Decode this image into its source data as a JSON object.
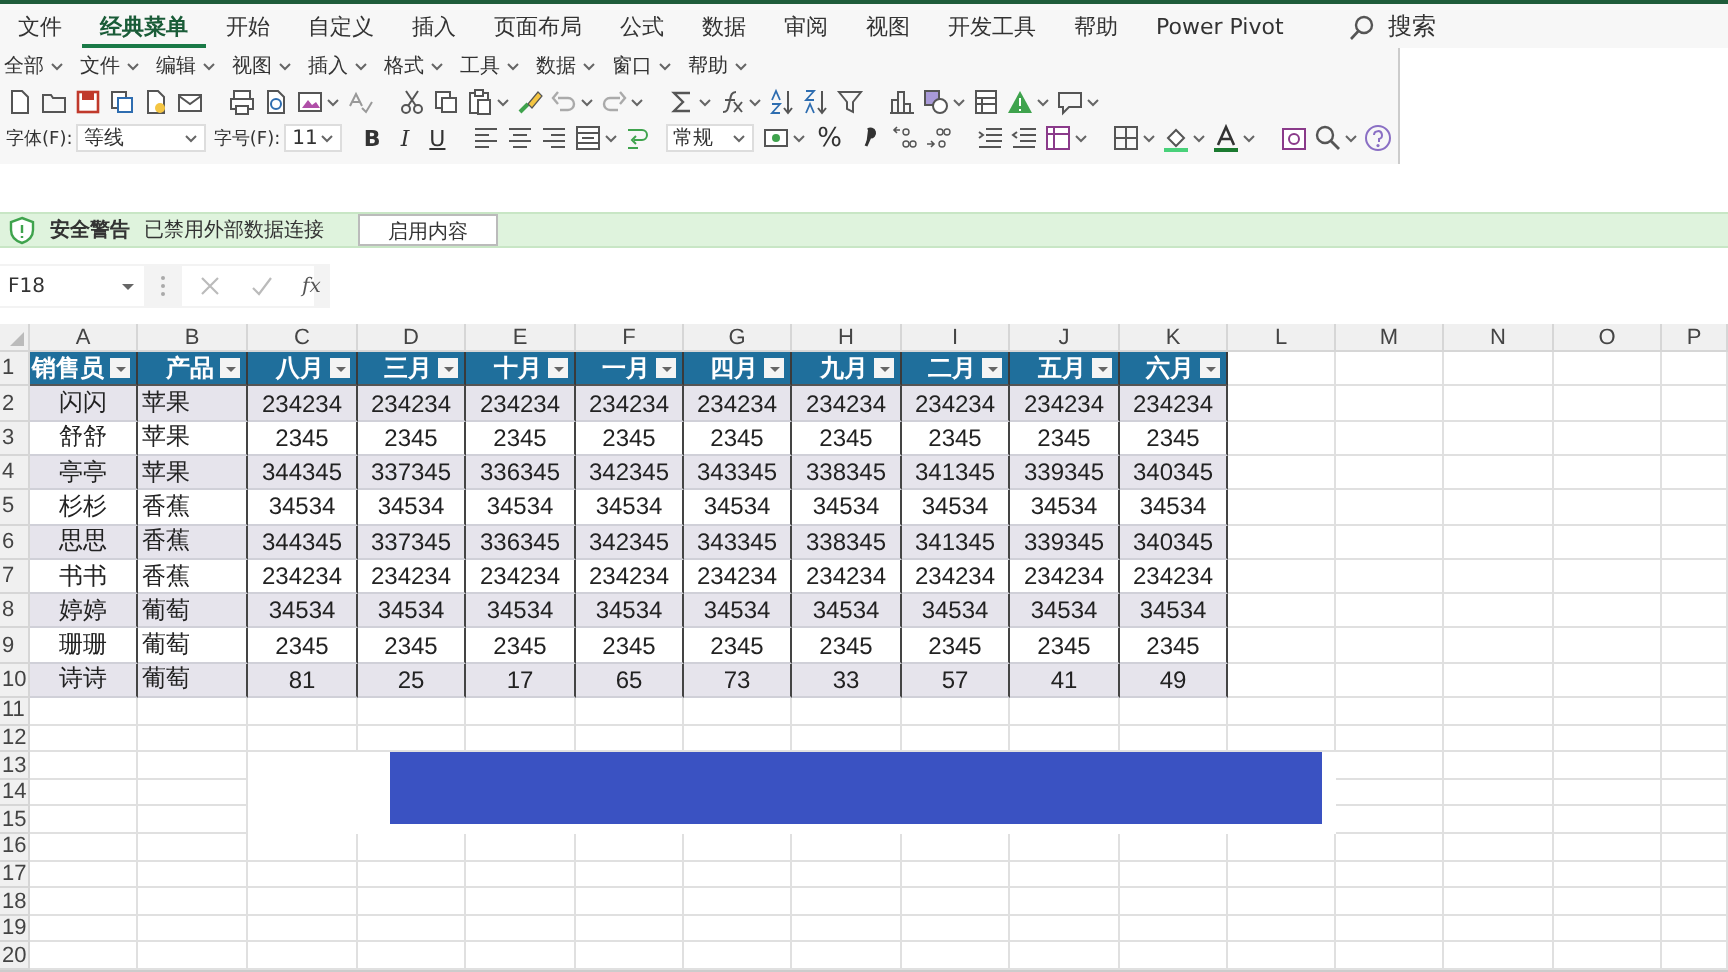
{
  "ribbon_tabs": [
    {
      "label": "文件",
      "selected": false
    },
    {
      "label": "经典菜单",
      "selected": true
    },
    {
      "label": "开始",
      "selected": false
    },
    {
      "label": "自定义",
      "selected": false
    },
    {
      "label": "插入",
      "selected": false
    },
    {
      "label": "页面布局",
      "selected": false
    },
    {
      "label": "公式",
      "selected": false
    },
    {
      "label": "数据",
      "selected": false
    },
    {
      "label": "审阅",
      "selected": false
    },
    {
      "label": "视图",
      "selected": false
    },
    {
      "label": "开发工具",
      "selected": false
    },
    {
      "label": "帮助",
      "selected": false
    },
    {
      "label": "Power Pivot",
      "selected": false
    }
  ],
  "search": {
    "label": "搜索"
  },
  "menu_bar": [
    "全部",
    "文件",
    "编辑",
    "视图",
    "插入",
    "格式",
    "工具",
    "数据",
    "窗口",
    "帮助"
  ],
  "format_toolbar": {
    "font_label": "字体(F):",
    "font": "等线",
    "size_label": "字号(F):",
    "size": "11",
    "bold": "B",
    "italic": "I",
    "underline": "U",
    "number_format": "常规",
    "percent": "%"
  },
  "security_bar": {
    "title": "安全警告",
    "message": "已禁用外部数据连接",
    "button": "启用内容"
  },
  "formula_bar": {
    "name_box": "F18",
    "fx": "fx"
  },
  "sheet": {
    "column_letters": [
      "A",
      "B",
      "C",
      "D",
      "E",
      "F",
      "G",
      "H",
      "I",
      "J",
      "K",
      "L",
      "M",
      "N",
      "O",
      "P"
    ],
    "row_numbers": [
      "1",
      "2",
      "3",
      "4",
      "5",
      "6",
      "7",
      "8",
      "9",
      "10",
      "11",
      "12",
      "13",
      "14",
      "15",
      "16",
      "17",
      "18",
      "19",
      "20"
    ],
    "table": {
      "headers": [
        {
          "label": "销售员",
          "filter": true
        },
        {
          "label": "产品",
          "filter": true
        },
        {
          "label": "八月",
          "filter": true
        },
        {
          "label": "三月",
          "filter": true
        },
        {
          "label": "十月",
          "filter": true
        },
        {
          "label": "一月",
          "filter": true
        },
        {
          "label": "四月",
          "filter": true
        },
        {
          "label": "九月",
          "filter": true
        },
        {
          "label": "二月",
          "filter": true
        },
        {
          "label": "五月",
          "filter": true
        },
        {
          "label": "六月",
          "filter": true
        }
      ],
      "rows": [
        [
          "闪闪",
          "苹果",
          "234234",
          "234234",
          "234234",
          "234234",
          "234234",
          "234234",
          "234234",
          "234234",
          "234234"
        ],
        [
          "舒舒",
          "苹果",
          "2345",
          "2345",
          "2345",
          "2345",
          "2345",
          "2345",
          "2345",
          "2345",
          "2345"
        ],
        [
          "亭亭",
          "苹果",
          "344345",
          "337345",
          "336345",
          "342345",
          "343345",
          "338345",
          "341345",
          "339345",
          "340345"
        ],
        [
          "杉杉",
          "香蕉",
          "34534",
          "34534",
          "34534",
          "34534",
          "34534",
          "34534",
          "34534",
          "34534",
          "34534"
        ],
        [
          "思思",
          "香蕉",
          "344345",
          "337345",
          "336345",
          "342345",
          "343345",
          "338345",
          "341345",
          "339345",
          "340345"
        ],
        [
          "书书",
          "香蕉",
          "234234",
          "234234",
          "234234",
          "234234",
          "234234",
          "234234",
          "234234",
          "234234",
          "234234"
        ],
        [
          "婷婷",
          "葡萄",
          "34534",
          "34534",
          "34534",
          "34534",
          "34534",
          "34534",
          "34534",
          "34534",
          "34534"
        ],
        [
          "珊珊",
          "葡萄",
          "2345",
          "2345",
          "2345",
          "2345",
          "2345",
          "2345",
          "2345",
          "2345",
          "2345"
        ],
        [
          "诗诗",
          "葡萄",
          "81",
          "25",
          "17",
          "65",
          "73",
          "33",
          "57",
          "41",
          "49"
        ]
      ]
    }
  }
}
